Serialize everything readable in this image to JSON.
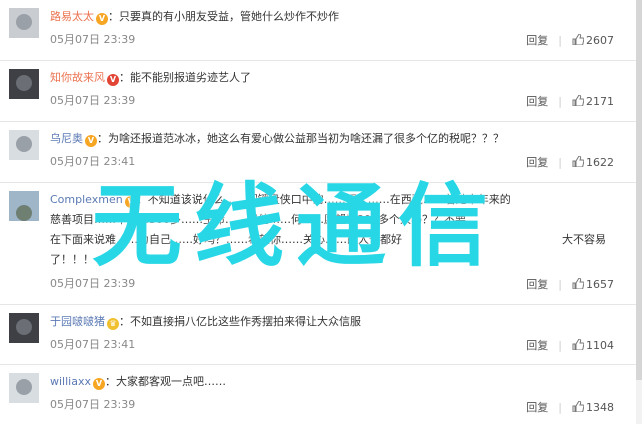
{
  "comments": [
    {
      "username": "路易太太",
      "text": "只要真的有小朋友受益，管她什么炒作不炒作",
      "timestamp": "05月07日 23:39",
      "reply_label": "回复",
      "likes": "2607",
      "badge": "V"
    },
    {
      "username": "知你故来风",
      "text": "能不能别报道劣迹艺人了",
      "timestamp": "05月07日 23:39",
      "reply_label": "回复",
      "likes": "2171",
      "badge": "V"
    },
    {
      "username": "乌尼奥",
      "text": "为啥还报道范冰冰，她这么有爱心做公益那当初为啥还漏了很多个亿的税呢？？？",
      "timestamp": "05月07日 23:41",
      "reply_label": "回复",
      "likes": "1622",
      "badge": "V"
    },
    {
      "username": "Complexmen",
      "text_lines": [
        "不知道该说什么……们键盘侠口中的……面人……在西藏……着她十年来的",
        "慈善项目……千……300多……生命……问他……何……愿望了300多个人吗？？不要",
        "在下面来说难……为自己……好吗？……希望你……关心……的人也都好",
        "了！！！"
      ],
      "text_tail": "大不容易",
      "timestamp": "05月07日 23:39",
      "reply_label": "回复",
      "likes": "1657",
      "badge": "V"
    },
    {
      "username": "于园啵啵猪",
      "text": "不如直接捐八亿比这些作秀摆拍来得让大众信服",
      "timestamp": "05月07日 23:41",
      "reply_label": "回复",
      "likes": "1104",
      "badge": "crown"
    },
    {
      "username": "williaxx",
      "text": "大家都客观一点吧……",
      "timestamp": "05月07日 23:39",
      "reply_label": "回复",
      "likes": "1348",
      "badge": "V"
    }
  ],
  "watermark": "无线通信",
  "colors": {
    "username": "#eb7350",
    "watermark": "#27d7e6",
    "meta": "#888888"
  }
}
